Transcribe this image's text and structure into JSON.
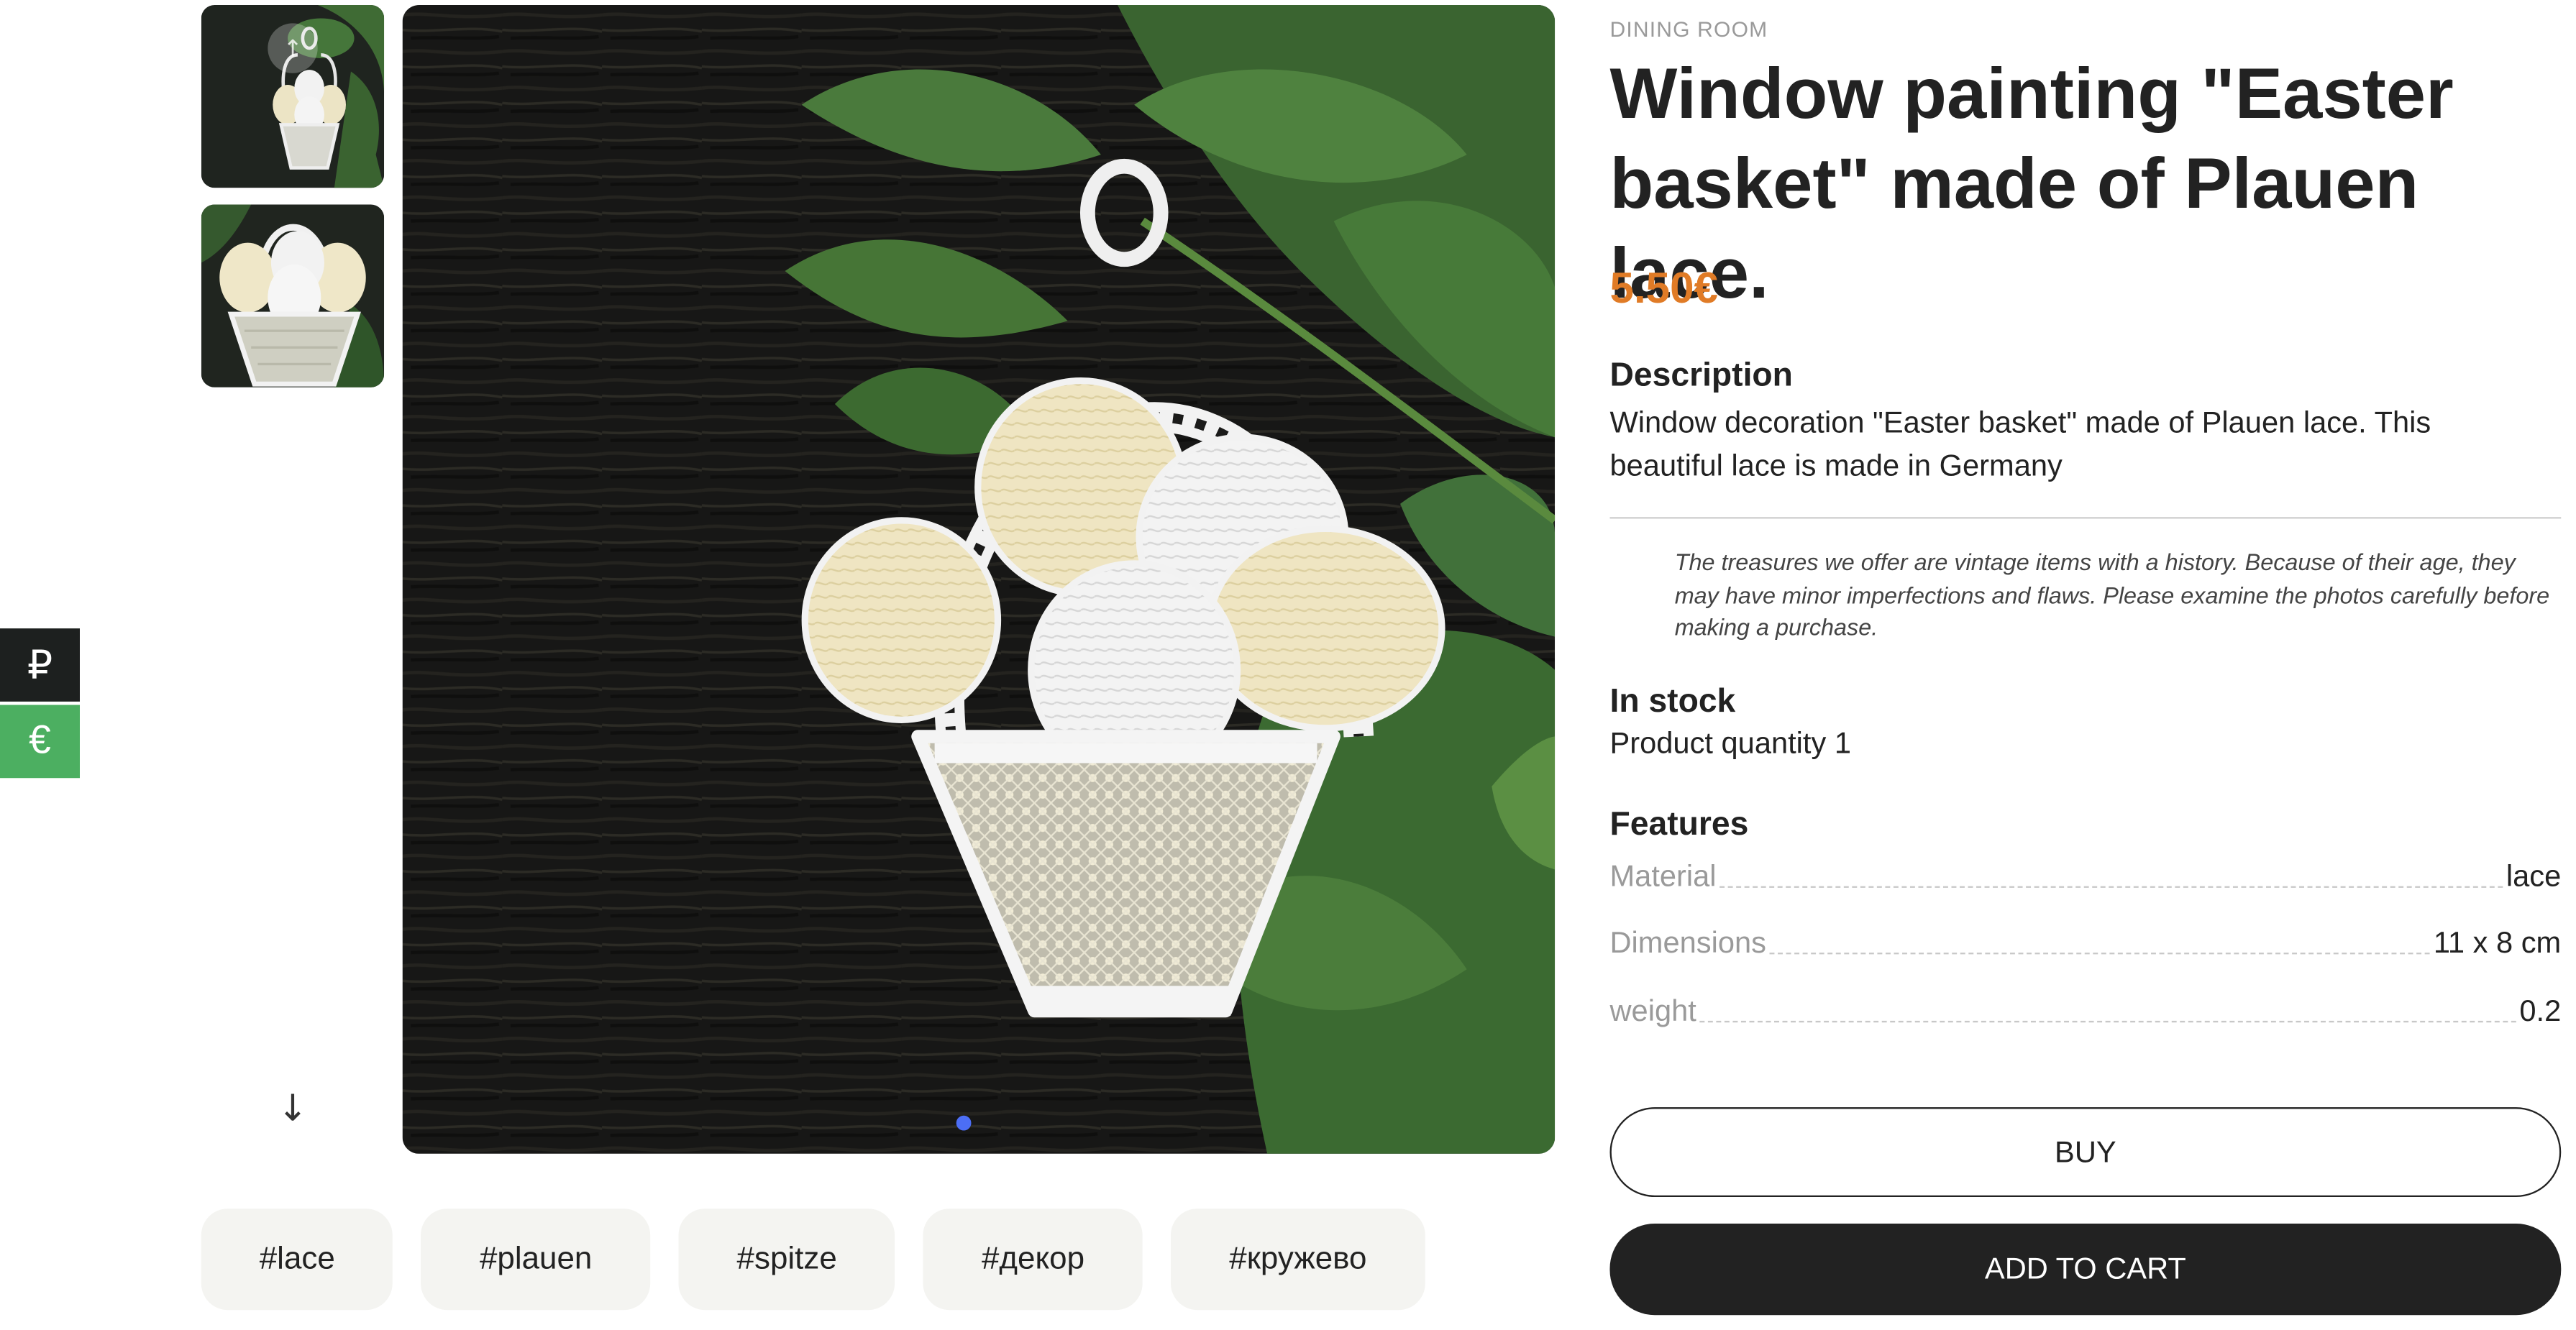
{
  "currency_switcher": {
    "rub_symbol": "₽",
    "eur_symbol": "€",
    "colors": {
      "rub_bg": "#1d201f",
      "eur_bg": "#4caf61"
    }
  },
  "gallery": {
    "thumbnails": [
      "thumbnail-1",
      "thumbnail-2"
    ],
    "down_arrow": "↓",
    "slides_count": 1,
    "active_slide": 1,
    "dot_color": "#4c6ef5"
  },
  "tags": [
    "#lace",
    "#plauen",
    "#spitze",
    "#декор",
    "#кружево"
  ],
  "product": {
    "category": "DINING ROOM",
    "title": "Window painting \"Easter basket\" made of Plauen lace.",
    "price": "5.50€",
    "price_color": "#e07b26",
    "description_heading": "Description",
    "description": "Window decoration \"Easter basket\" made of Plauen lace. This beautiful lace is made in Germany",
    "vintage_note": "The treasures we offer are vintage items with a history. Because of their age, they may have minor imperfections and flaws. Please examine the photos carefully before making a purchase.",
    "stock_heading": "In stock",
    "stock_text": "Product quantity 1",
    "features_heading": "Features",
    "features": [
      {
        "name": "Material",
        "value": "lace"
      },
      {
        "name": "Dimensions",
        "value": "11 x 8 cm"
      },
      {
        "name": "weight",
        "value": "0.2"
      }
    ]
  },
  "actions": {
    "buy_label": "BUY",
    "add_to_cart_label": "ADD TO CART"
  }
}
